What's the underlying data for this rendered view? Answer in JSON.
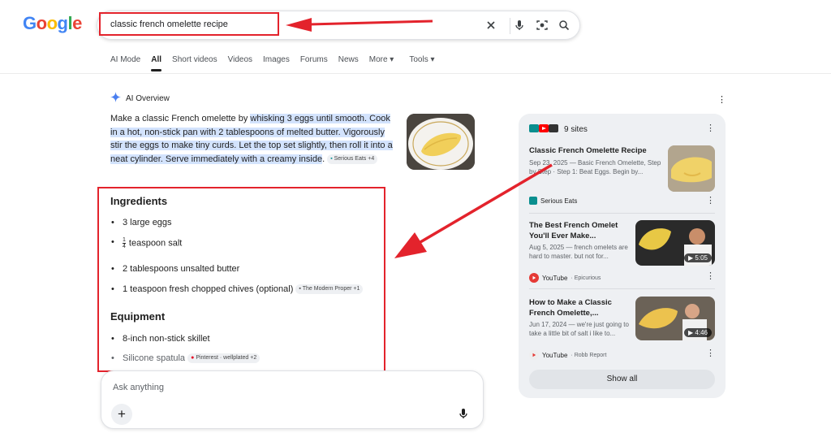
{
  "brand": {
    "logo_text": "Google",
    "logo_letters": [
      "G",
      "o",
      "o",
      "g",
      "l",
      "e"
    ],
    "logo_colors": [
      "#4285F4",
      "#EA4335",
      "#FBBC05",
      "#4285F4",
      "#34A853",
      "#EA4335"
    ]
  },
  "search": {
    "query": "classic french omelette recipe",
    "icons": [
      "close-icon",
      "mic-icon",
      "lens-icon",
      "search-icon"
    ]
  },
  "tabs": [
    {
      "label": "AI Mode",
      "active": false
    },
    {
      "label": "All",
      "active": true
    },
    {
      "label": "Short videos",
      "active": false
    },
    {
      "label": "Videos",
      "active": false
    },
    {
      "label": "Images",
      "active": false
    },
    {
      "label": "Forums",
      "active": false
    },
    {
      "label": "News",
      "active": false
    },
    {
      "label": "More ▾",
      "active": false
    },
    {
      "label": "Tools ▾",
      "active": false
    }
  ],
  "ai_overview": {
    "label": "AI Overview",
    "summary_plain": "Make a classic French omelette by ",
    "summary_highlight": "whisking 3 eggs until smooth. Cook in a hot, non-stick pan with 2 tablespoons of melted butter. Vigorously stir the eggs to make tiny curds. Let the top set slightly, then roll it into a neat cylinder. Serve immediately with a creamy inside",
    "summary_end": ".",
    "summary_chip": "Serious Eats +4",
    "ingredients_heading": "Ingredients",
    "ingredients": {
      "eggs": "3 large eggs",
      "salt_num": "1",
      "salt_den": "4",
      "salt": "teaspoon salt",
      "butter": "2 tablespoons unsalted butter",
      "chives": "1 teaspoon fresh chopped chives (optional)",
      "chives_chip": "The Modern Proper +1"
    },
    "equipment_heading": "Equipment",
    "equipment": {
      "skillet": "8-inch non-stick skillet",
      "spatula": "Silicone spatula",
      "spatula_chip": "Pinterest · wellplated +2"
    }
  },
  "ask": {
    "placeholder": "Ask anything",
    "plus": "+"
  },
  "sources": {
    "count_label": "9 sites",
    "cards": [
      {
        "title": "Classic French Omelette Recipe",
        "snippet": "Sep 23, 2025 — Basic French Omelette, Step by Step · Step 1: Beat Eggs. Begin by...",
        "source": "Serious Eats",
        "source_sub": ""
      },
      {
        "title": "The Best French Omelet You'll Ever Make...",
        "snippet": "Aug 5, 2025 — french omelets are hard to master. but not for...",
        "source": "YouTube",
        "source_sub": "· Epicurious",
        "duration": "5:05"
      },
      {
        "title": "How to Make a Classic French Omelette,...",
        "snippet": "Jun 17, 2024 — we're just going to take a little bit of salt i like to...",
        "source": "YouTube",
        "source_sub": "· Robb Report",
        "duration": "4:46"
      }
    ],
    "show_all": "Show all"
  },
  "colors": {
    "highlight": "#d3e3fd",
    "annotation_red": "#e3232c",
    "panel_bg": "#eef0f3"
  }
}
